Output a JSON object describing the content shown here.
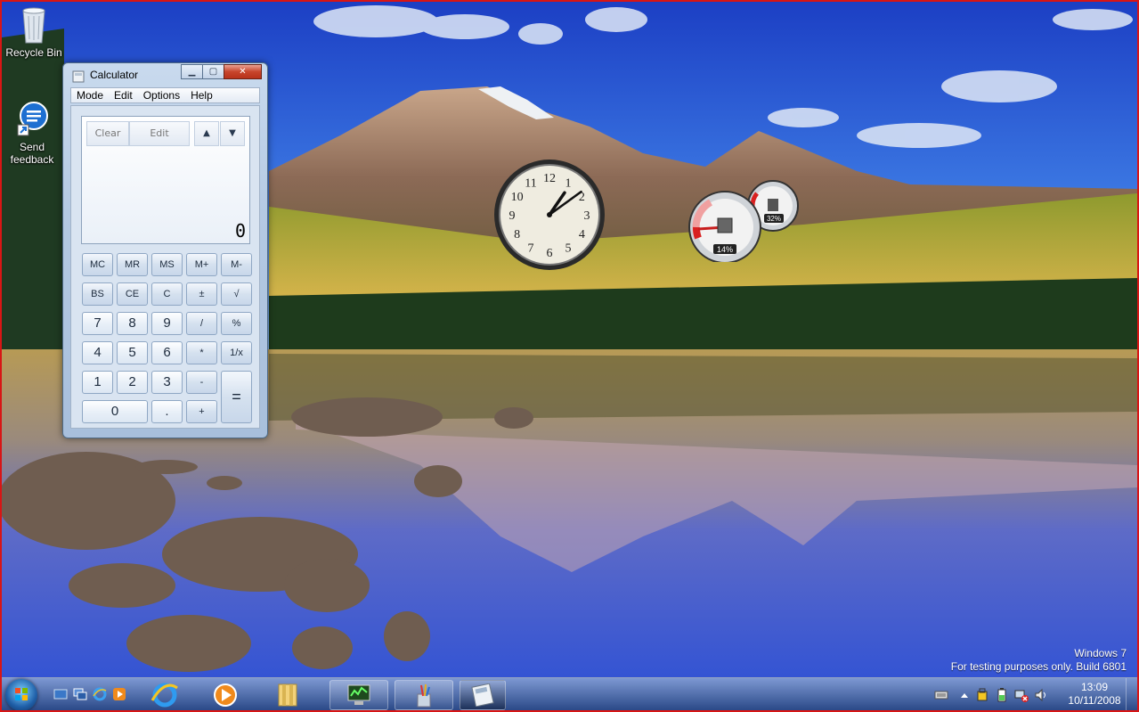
{
  "desktop": {
    "icons": [
      {
        "label": "Recycle Bin"
      },
      {
        "label": "Send feedback"
      }
    ]
  },
  "calculator": {
    "title": "Calculator",
    "caption_buttons": {
      "minimize": "▁",
      "maximize": "▢",
      "close": "✕"
    },
    "menu": [
      "Mode",
      "Edit",
      "Options",
      "Help"
    ],
    "history_toolbar": {
      "clear": "Clear",
      "edit": "Edit",
      "up": "▲",
      "down": "▼"
    },
    "display_value": "0",
    "memory_row": [
      "MC",
      "MR",
      "MS",
      "M+",
      "M-"
    ],
    "row2": [
      "BS",
      "CE",
      "C",
      "±",
      "√"
    ],
    "row3": [
      "7",
      "8",
      "9",
      "/",
      "%"
    ],
    "row4": [
      "4",
      "5",
      "6",
      "*",
      "1/x"
    ],
    "row5": [
      "1",
      "2",
      "3",
      "-"
    ],
    "row6": [
      "0",
      ".",
      "+"
    ],
    "equals": "="
  },
  "gadgets": {
    "clock": {
      "time_hour": 1,
      "time_minute": 9,
      "numerals": [
        "12",
        "1",
        "2",
        "3",
        "4",
        "5",
        "6",
        "7",
        "8",
        "9",
        "10",
        "11"
      ]
    },
    "cpu_meter": {
      "cpu_percent": "14%",
      "memory_percent": "32%",
      "cpu_value": 14,
      "memory_value": 32
    }
  },
  "watermark": {
    "line1": "Windows  7",
    "line2": "For testing purposes only. Build 6801"
  },
  "taskbar": {
    "clock_time": "13:09",
    "clock_date": "10/11/2008"
  }
}
